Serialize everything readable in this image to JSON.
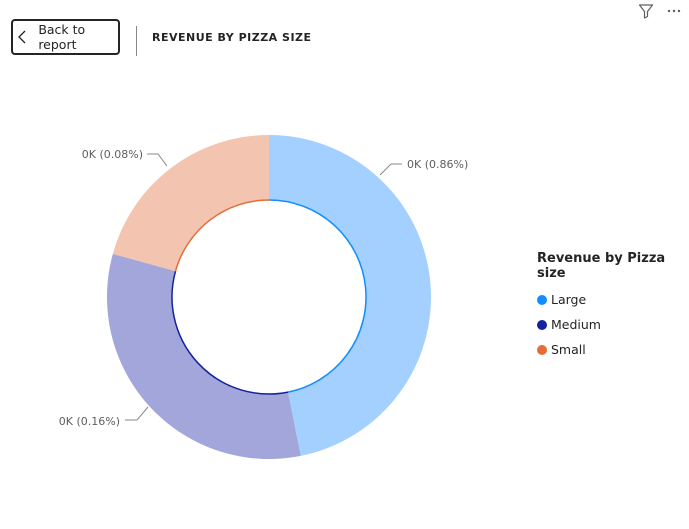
{
  "header": {
    "back_label": "Back to report",
    "title": "REVENUE BY PIZZA SIZE",
    "icons": [
      "filter-icon",
      "more-options-icon"
    ]
  },
  "chart_data": {
    "type": "donut",
    "legend_title": "Revenue by Pizza size",
    "legend_placement": "right",
    "series": [
      {
        "name": "Large",
        "share": 0.4686,
        "label": "0K (0.86%)",
        "color": "#a3d0ff",
        "legend_color": "#118dff",
        "edge_color": "#118dff"
      },
      {
        "name": "Medium",
        "share": 0.3243,
        "label": "0K (0.16%)",
        "color": "#a3a6da",
        "legend_color": "#12239e",
        "edge_color": "#12239e"
      },
      {
        "name": "Small",
        "share": 0.2071,
        "label": "0K (0.08%)",
        "color": "#f3c5b0",
        "legend_color": "#e66c37",
        "edge_color": "#e66c37"
      }
    ]
  }
}
